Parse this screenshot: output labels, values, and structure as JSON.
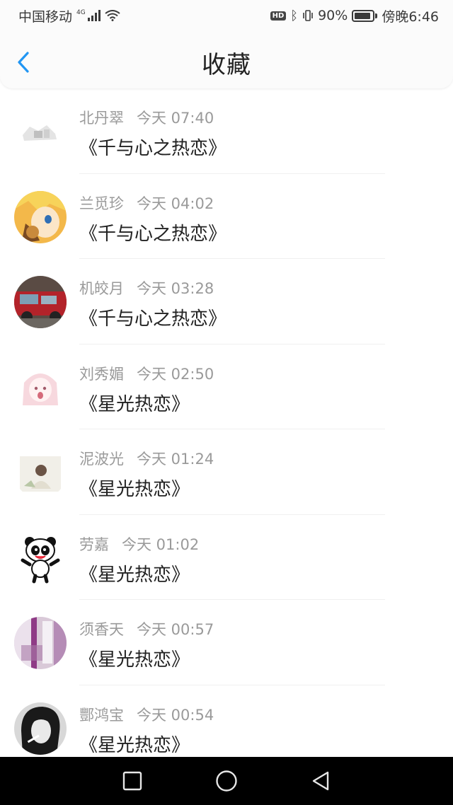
{
  "status_bar": {
    "carrier": "中国移动",
    "network": "4G",
    "hd": "HD",
    "battery_percent": "90%",
    "battery_level": 0.9,
    "time": "傍晚6:46"
  },
  "header": {
    "title": "收藏",
    "back_icon": "chevron-left-icon",
    "back_color": "#2196f3"
  },
  "favorites": [
    {
      "user": "北丹翠",
      "time": "今天 07:40",
      "book": "《千与心之热恋》"
    },
    {
      "user": "兰觅珍",
      "time": "今天 04:02",
      "book": "《千与心之热恋》"
    },
    {
      "user": "机皎月",
      "time": "今天 03:28",
      "book": "《千与心之热恋》"
    },
    {
      "user": "刘秀媚",
      "time": "今天 02:50",
      "book": "《星光热恋》"
    },
    {
      "user": "泥波光",
      "time": "今天 01:24",
      "book": "《星光热恋》"
    },
    {
      "user": "劳嘉",
      "time": "今天 01:02",
      "book": "《星光热恋》"
    },
    {
      "user": "须香天",
      "time": "今天 00:57",
      "book": "《星光热恋》"
    },
    {
      "user": "酆鸿宝",
      "time": "今天 00:54",
      "book": "《星光热恋》"
    }
  ],
  "system_nav": {
    "recent_icon": "square-icon",
    "home_icon": "circle-icon",
    "back_icon": "triangle-back-icon"
  }
}
